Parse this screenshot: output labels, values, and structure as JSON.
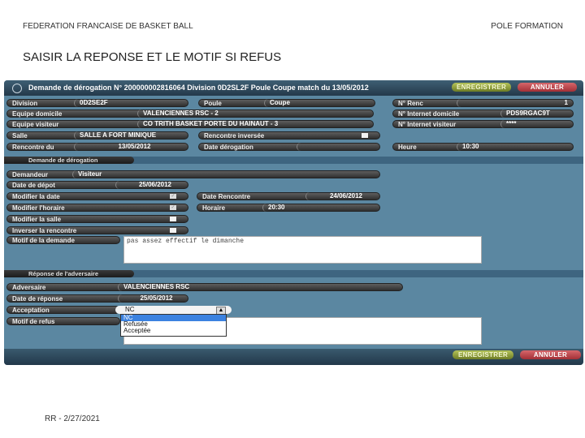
{
  "slide": {
    "org": "FEDERATION FRANCAISE DE BASKET BALL",
    "dept": "POLE FORMATION",
    "title": "SAISIR LA REPONSE ET LE MOTIF SI REFUS",
    "footer": "RR - 2/27/2021"
  },
  "panel": {
    "title": "Demande de dérogation N° 200000002816064 Division 0D2SL2F Poule Coupe match du 13/05/2012",
    "save_label": "ENREGISTRER",
    "cancel_label": "ANNULER",
    "colors": {
      "panel": "#5b87a1",
      "save": "#9aab3f",
      "cancel": "#c9484e"
    }
  },
  "match": {
    "division": {
      "label": "Division",
      "value": "0D2SE2F"
    },
    "poule": {
      "label": "Poule",
      "value": "Coupe"
    },
    "num_renc": {
      "label": "N° Renc",
      "value": "1"
    },
    "equipe_dom": {
      "label": "Equipe domicile",
      "value": "VALENCIENNES RSC - 2"
    },
    "internet_dom": {
      "label": "N° Internet domicile",
      "value": "PDS9RGAC9T"
    },
    "equipe_vis": {
      "label": "Equipe visiteur",
      "value": "CO TRITH BASKET PORTE DU HAINAUT - 3"
    },
    "internet_vis": {
      "label": "N° Internet visiteur",
      "value": "****"
    },
    "salle": {
      "label": "Salle",
      "value": "SALLE A FORT MINIQUE"
    },
    "inversee": {
      "label": "Rencontre inversée",
      "checked": false
    },
    "rencontre_du": {
      "label": "Rencontre du",
      "value": "13/05/2012"
    },
    "date_derog": {
      "label": "Date dérogation",
      "value": ""
    },
    "heure": {
      "label": "Heure",
      "value": "10:30"
    }
  },
  "demande": {
    "section": "Demande de dérogation",
    "demandeur": {
      "label": "Demandeur",
      "value": "Visiteur"
    },
    "date_depot": {
      "label": "Date de dépot",
      "value": "25/06/2012"
    },
    "mod_date": {
      "label": "Modifier la date",
      "checked": true
    },
    "date_renc": {
      "label": "Date Rencontre",
      "value": "24/06/2012"
    },
    "mod_horaire": {
      "label": "Modifier l'horaire",
      "checked": true
    },
    "horaire": {
      "label": "Horaire",
      "value": "20:30"
    },
    "mod_salle": {
      "label": "Modifier la salle",
      "checked": false
    },
    "inverser": {
      "label": "Inverser la rencontre",
      "checked": false
    },
    "motif": {
      "label": "Motif de la demande",
      "value": "pas assez effectif le dimanche"
    }
  },
  "reponse": {
    "section": "Réponse de l'adversaire",
    "adversaire": {
      "label": "Adversaire",
      "value": "VALENCIENNES RSC"
    },
    "date_rep": {
      "label": "Date de réponse",
      "value": "25/05/2012"
    },
    "acceptation": {
      "label": "Acceptation",
      "value": "NC",
      "options": [
        "NC",
        "Refusée",
        "Acceptée"
      ]
    },
    "motif_refus": {
      "label": "Motif de refus",
      "value": ""
    }
  }
}
